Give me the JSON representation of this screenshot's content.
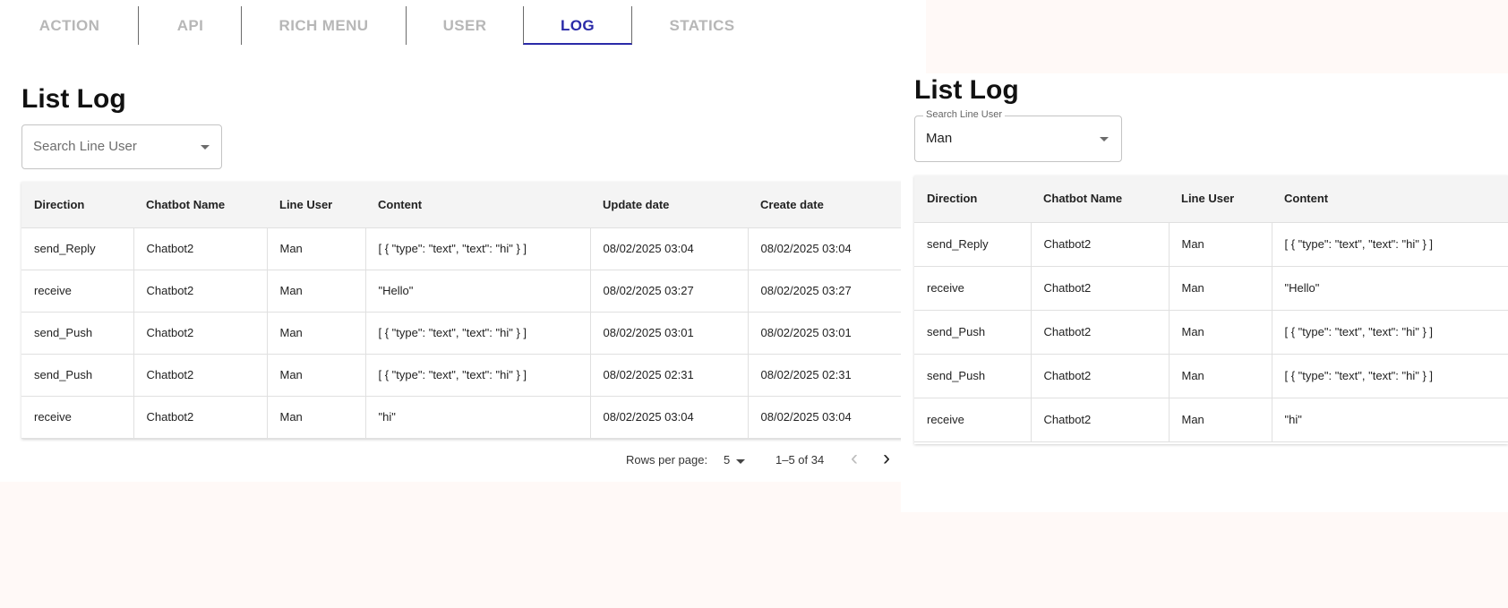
{
  "tabs": [
    {
      "label": "ACTION"
    },
    {
      "label": "API"
    },
    {
      "label": "RICH MENU"
    },
    {
      "label": "USER"
    },
    {
      "label": "LOG"
    },
    {
      "label": "STATICS"
    }
  ],
  "left": {
    "title": "List Log",
    "search": {
      "placeholder": "Search Line User"
    },
    "columns": [
      "Direction",
      "Chatbot Name",
      "Line User",
      "Content",
      "Update date",
      "Create date"
    ],
    "rows": [
      [
        "send_Reply",
        "Chatbot2",
        "Man",
        "[ { \"type\": \"text\", \"text\": \"hi\" } ]",
        "08/02/2025 03:04",
        "08/02/2025 03:04"
      ],
      [
        "receive",
        "Chatbot2",
        "Man",
        "\"Hello\"",
        "08/02/2025 03:27",
        "08/02/2025 03:27"
      ],
      [
        "send_Push",
        "Chatbot2",
        "Man",
        "[ { \"type\": \"text\", \"text\": \"hi\" } ]",
        "08/02/2025 03:01",
        "08/02/2025 03:01"
      ],
      [
        "send_Push",
        "Chatbot2",
        "Man",
        "[ { \"type\": \"text\", \"text\": \"hi\" } ]",
        "08/02/2025 02:31",
        "08/02/2025 02:31"
      ],
      [
        "receive",
        "Chatbot2",
        "Man",
        "\"hi\"",
        "08/02/2025 03:04",
        "08/02/2025 03:04"
      ]
    ],
    "pagination": {
      "rows_per_page_label": "Rows per page:",
      "rows_per_page_value": "5",
      "range": "1–5 of 34",
      "prev_icon": "‹",
      "next_icon": "›"
    }
  },
  "right": {
    "title": "List Log",
    "search": {
      "label": "Search Line User",
      "value": "Man"
    },
    "columns": [
      "Direction",
      "Chatbot Name",
      "Line User",
      "Content"
    ],
    "rows": [
      [
        "send_Reply",
        "Chatbot2",
        "Man",
        "[ { \"type\": \"text\", \"text\": \"hi\" } ]"
      ],
      [
        "receive",
        "Chatbot2",
        "Man",
        "\"Hello\""
      ],
      [
        "send_Push",
        "Chatbot2",
        "Man",
        "[ { \"type\": \"text\", \"text\": \"hi\" } ]"
      ],
      [
        "send_Push",
        "Chatbot2",
        "Man",
        "[ { \"type\": \"text\", \"text\": \"hi\" } ]"
      ],
      [
        "receive",
        "Chatbot2",
        "Man",
        "\"hi\""
      ]
    ]
  },
  "colors": {
    "active_tab": "#2a2aa8",
    "inactive_tab": "#b7b7b7",
    "background": "#fff9f7"
  }
}
